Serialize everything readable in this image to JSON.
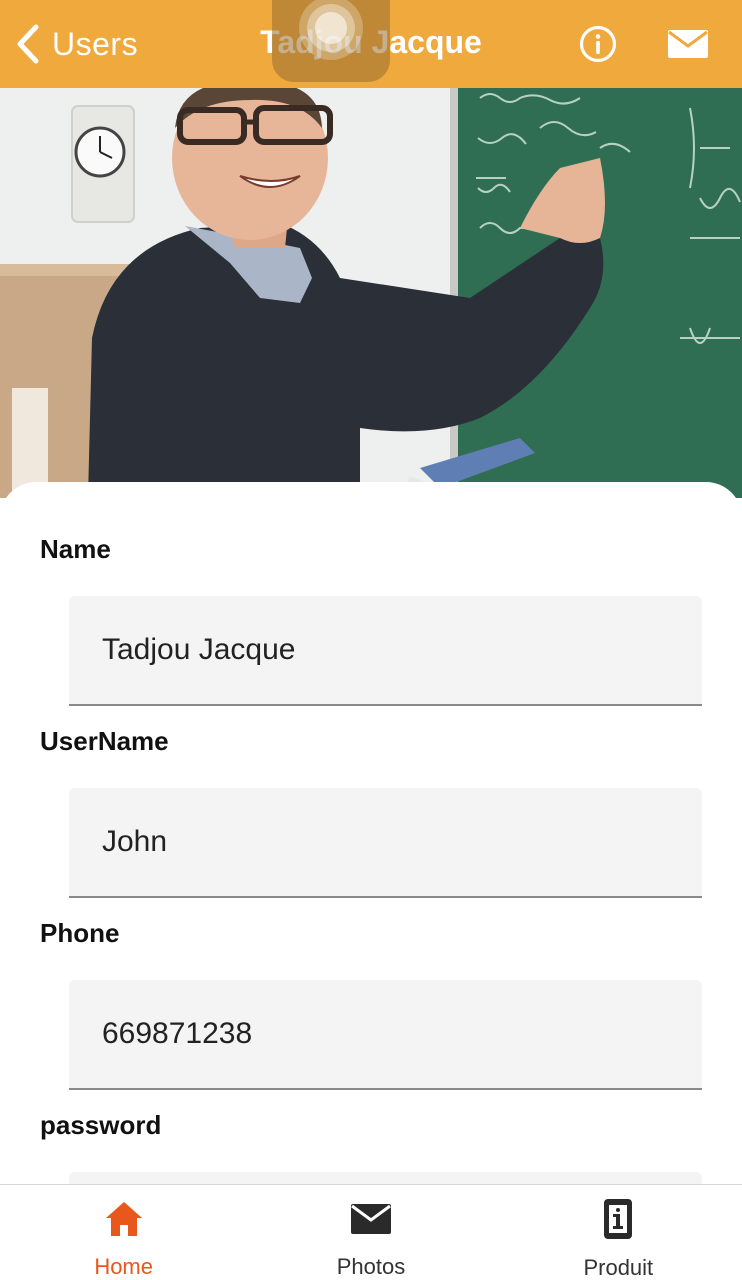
{
  "header": {
    "back_label": "Users",
    "title": "Tadjou Jacque",
    "info_icon": "info-circle-icon",
    "mail_icon": "envelope-icon",
    "background_color": "#f0a93c"
  },
  "hero": {
    "image": "photo of a smiling man with glasses writing on a green chalkboard"
  },
  "form": {
    "fields": [
      {
        "label": "Name",
        "value": "Tadjou Jacque"
      },
      {
        "label": "UserName",
        "value": "John"
      },
      {
        "label": "Phone",
        "value": "669871238"
      },
      {
        "label": "password",
        "value": ""
      }
    ]
  },
  "tabbar": {
    "tabs": [
      {
        "label": "Home",
        "icon": "home-icon",
        "active": true
      },
      {
        "label": "Photos",
        "icon": "envelope-icon",
        "active": false
      },
      {
        "label": "Produit",
        "icon": "phone-info-icon",
        "active": false
      }
    ],
    "active_color": "#e8571c"
  }
}
